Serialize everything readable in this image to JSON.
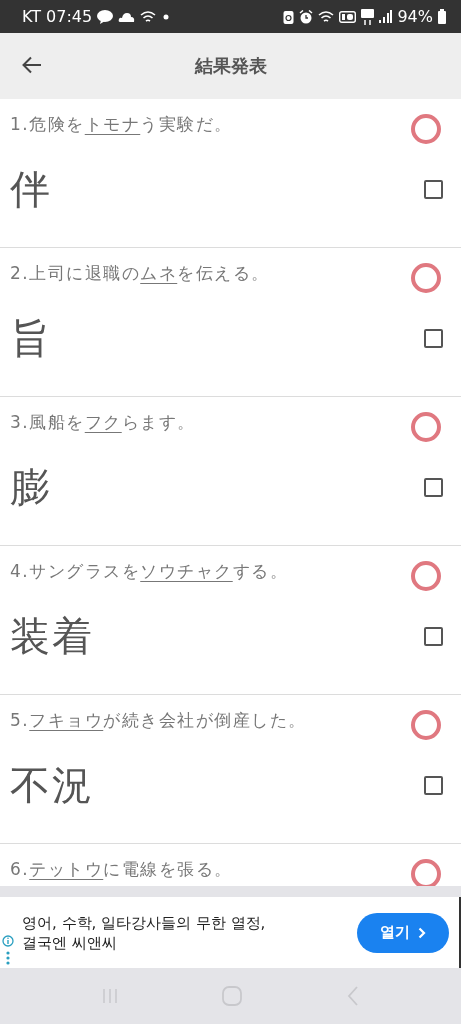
{
  "status_bar": {
    "carrier_time": "KT 07:45",
    "battery": "94%"
  },
  "app_bar": {
    "title": "結果発表"
  },
  "questions": [
    {
      "number": "1.",
      "before": "危険を",
      "underlined": "トモナ",
      "after": "う実験だ。",
      "answer": "伴",
      "kind": "circle",
      "checked": false
    },
    {
      "number": "2.",
      "before": "上司に退職の",
      "underlined": "ムネ",
      "after": "を伝える。",
      "answer": "旨",
      "kind": "circle",
      "checked": false
    },
    {
      "number": "3.",
      "before": "風船を",
      "underlined": "フク",
      "after": "らます。",
      "answer": "膨",
      "kind": "circle",
      "checked": false
    },
    {
      "number": "4.",
      "before": "サングラスを",
      "underlined": "ソウチャク",
      "after": "する。",
      "answer": "装着",
      "kind": "circle",
      "checked": false
    },
    {
      "number": "5.",
      "underlined": "フキョウ",
      "after": "が続き会社が倒産した。",
      "answer": "不況",
      "kind": "circle",
      "checked": false
    },
    {
      "number": "6.",
      "underlined": "テットウ",
      "after": "に電線を張る。",
      "kind": "circle"
    }
  ],
  "ad": {
    "text": "영어, 수학, 일타강사들의 무한 열정,\n결국엔 씨앤씨",
    "button": "열기"
  }
}
